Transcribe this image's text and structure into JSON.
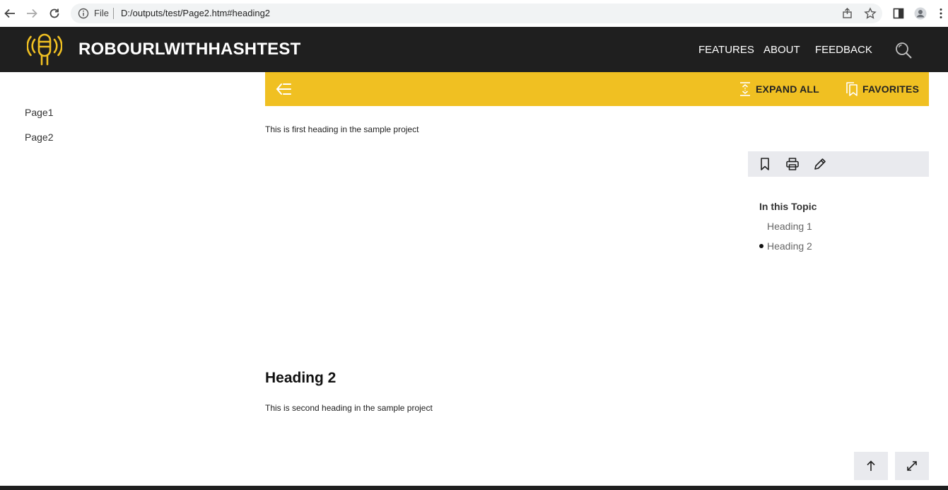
{
  "browser": {
    "scheme_label": "File",
    "url": "D:/outputs/test/Page2.htm#heading2"
  },
  "header": {
    "title": "ROBOURLWITHHASHTEST",
    "nav": [
      "FEATURES",
      "ABOUT",
      "FEEDBACK"
    ]
  },
  "sidebar": {
    "items": [
      "Page1",
      "Page2"
    ]
  },
  "toolbar": {
    "expand_all": "EXPAND ALL",
    "favorites": "FAVORITES"
  },
  "content": {
    "intro_text": "This is first heading in the sample project",
    "heading2": "Heading 2",
    "heading2_text": "This is second heading in the sample project"
  },
  "topic_panel": {
    "title": "In this Topic",
    "links": [
      "Heading 1",
      "Heading 2"
    ],
    "active_index": 1
  },
  "colors": {
    "header_bg": "#1f1f1f",
    "accent": "#f0c022",
    "panel_bg": "#e9eaee"
  }
}
